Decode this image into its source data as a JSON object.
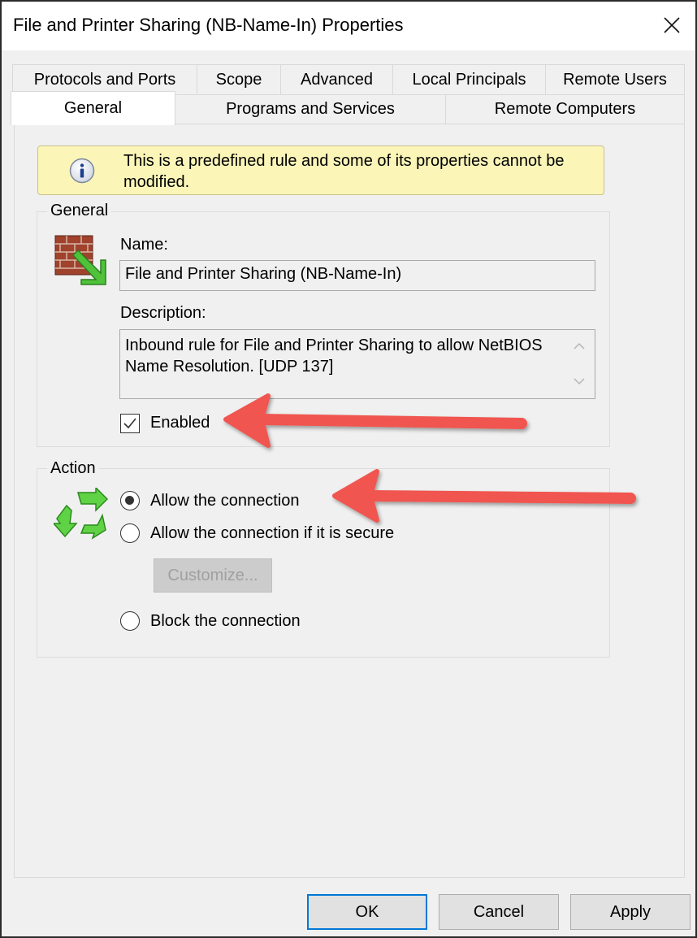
{
  "window": {
    "title": "File and Printer Sharing (NB-Name-In) Properties"
  },
  "tabs": {
    "row1": [
      "Protocols and Ports",
      "Scope",
      "Advanced",
      "Local Principals",
      "Remote Users"
    ],
    "row2": [
      "General",
      "Programs and Services",
      "Remote Computers"
    ],
    "active": "General"
  },
  "info_banner": {
    "text": "This is a predefined rule and some of its properties cannot be modified."
  },
  "general_group": {
    "label": "General",
    "name_label": "Name:",
    "name_value": "File and Printer Sharing (NB-Name-In)",
    "description_label": "Description:",
    "description_value": "Inbound rule for File and Printer Sharing to allow NetBIOS Name Resolution. [UDP 137]",
    "enabled_label": "Enabled",
    "enabled_checked": true
  },
  "action_group": {
    "label": "Action",
    "options": [
      {
        "label": "Allow the connection",
        "selected": true
      },
      {
        "label": "Allow the connection if it is secure",
        "selected": false
      },
      {
        "label": "Block the connection",
        "selected": false
      }
    ],
    "customize_label": "Customize..."
  },
  "footer": {
    "ok_label": "OK",
    "cancel_label": "Cancel",
    "apply_label": "Apply"
  },
  "colors": {
    "annotation_arrow": "#f0554f",
    "info_banner_bg": "#fbf6b8",
    "default_button_border": "#0078d7"
  },
  "icons": [
    "close-icon",
    "info-icon",
    "firewall-rule-icon",
    "refresh-action-icon",
    "check-icon",
    "scroll-up-icon",
    "scroll-down-icon"
  ]
}
